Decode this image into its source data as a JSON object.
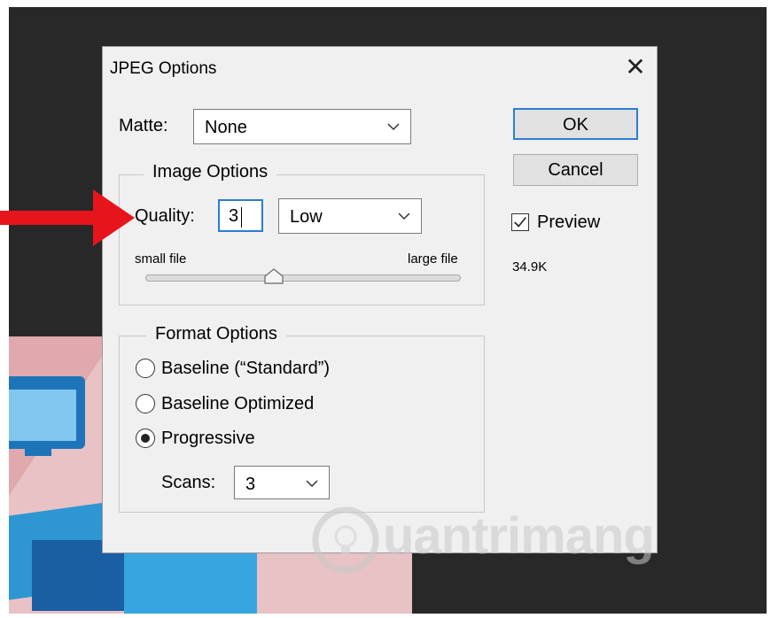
{
  "dialog": {
    "title": "JPEG Options",
    "close_glyph": "✕"
  },
  "matte": {
    "label": "Matte:",
    "value": "None"
  },
  "image_options": {
    "legend": "Image Options",
    "quality_label": "Quality:",
    "quality_value": "3",
    "quality_preset": "Low",
    "small_file_label": "small file",
    "large_file_label": "large file",
    "slider_level": 3,
    "slider_min": 0,
    "slider_max": 12
  },
  "format_options": {
    "legend": "Format Options",
    "options": [
      {
        "label": "Baseline (“Standard”)",
        "selected": false
      },
      {
        "label": "Baseline Optimized",
        "selected": false
      },
      {
        "label": "Progressive",
        "selected": true
      }
    ],
    "scans_label": "Scans:",
    "scans_value": "3"
  },
  "buttons": {
    "ok": "OK",
    "cancel": "Cancel"
  },
  "preview": {
    "label": "Preview",
    "checked": true,
    "file_size": "34.9K"
  },
  "watermark": {
    "text": "uantrimang"
  },
  "colors": {
    "accent": "#2d7dd2",
    "arrow": "#e8141b",
    "canvas": "#282828"
  }
}
